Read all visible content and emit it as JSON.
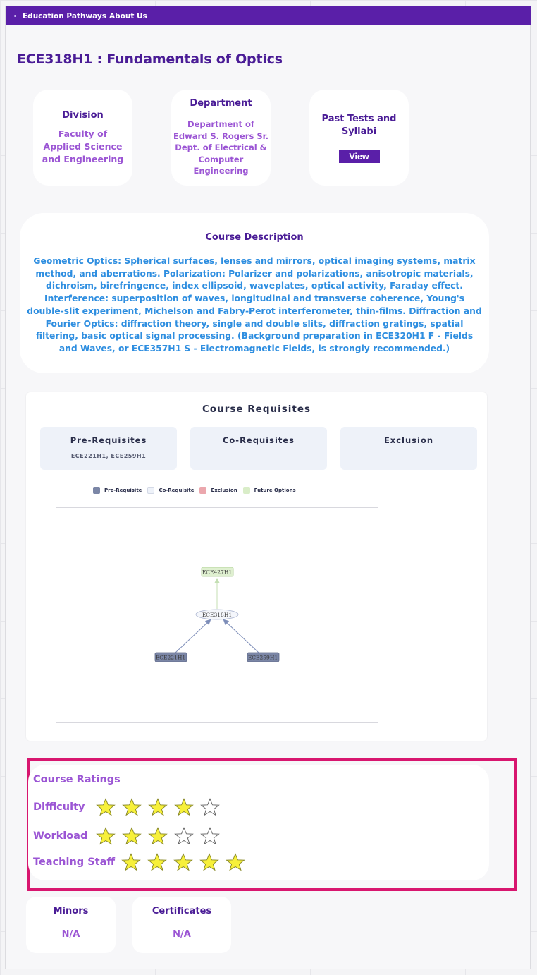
{
  "nav": {
    "links": [
      "Education Pathways",
      "About Us"
    ]
  },
  "course": {
    "title": "ECE318H1 : Fundamentals of Optics"
  },
  "info": {
    "division_label": "Division",
    "division_value": "Faculty of Applied Science and Engineering",
    "department_label": "Department",
    "department_value": "Department of Edward S. Rogers Sr. Dept. of Electrical & Computer Engineering",
    "past_tests_label": "Past Tests and Syllabi",
    "view_label": "View"
  },
  "description": {
    "title": "Course Description",
    "text": "Geometric Optics: Spherical surfaces, lenses and mirrors, optical imaging systems, matrix method, and aberrations. Polarization: Polarizer and polarizations, anisotropic materials, dichroism, birefringence, index ellipsoid, waveplates, optical activity, Faraday effect. Interference: superposition of waves, longitudinal and transverse coherence, Young's double-slit experiment, Michelson and Fabry-Perot interferometer, thin-films. Diffraction and Fourier Optics: diffraction theory, single and double slits, diffraction gratings, spatial filtering, basic optical signal processing. (Background preparation in ECE320H1 F - Fields and Waves, or ECE357H1 S - Electromagnetic Fields, is strongly recommended.)"
  },
  "requisites": {
    "title": "Course Requisites",
    "prereq_label": "Pre-Requisites",
    "prereq_list": "ECE221H1, ECE259H1",
    "coreq_label": "Co-Requisites",
    "coreq_list": "",
    "exclusion_label": "Exclusion",
    "exclusion_list": "",
    "legend": [
      {
        "label": "Pre-Requisite",
        "color": "#7b86a6"
      },
      {
        "label": "Co-Requisite",
        "color": "#eef2f9"
      },
      {
        "label": "Exclusion",
        "color": "#eba7ad"
      },
      {
        "label": "Future Options",
        "color": "#d9edc8"
      }
    ],
    "graph": {
      "nodes": [
        {
          "id": "ECE427H1",
          "type": "future",
          "fill": "#dff0d0",
          "stroke": "#a7c98c"
        },
        {
          "id": "ECE318H1",
          "type": "current",
          "fill": "#f4f6fb",
          "stroke": "#aab4cf"
        },
        {
          "id": "ECE221H1",
          "type": "prereq",
          "fill": "#7b86a6",
          "stroke": "#5d6787"
        },
        {
          "id": "ECE259H1",
          "type": "prereq",
          "fill": "#7b86a6",
          "stroke": "#5d6787"
        }
      ]
    }
  },
  "ratings": {
    "title": "Course Ratings",
    "difficulty_label": "Difficulty",
    "difficulty": 4,
    "workload_label": "Workload",
    "workload": 3,
    "teaching_label": "Teaching Staff",
    "teaching": 5,
    "max": 5,
    "star_color": "#f7f03a"
  },
  "minors": {
    "label": "Minors",
    "value": "N/A"
  },
  "certificates": {
    "label": "Certificates",
    "value": "N/A"
  }
}
